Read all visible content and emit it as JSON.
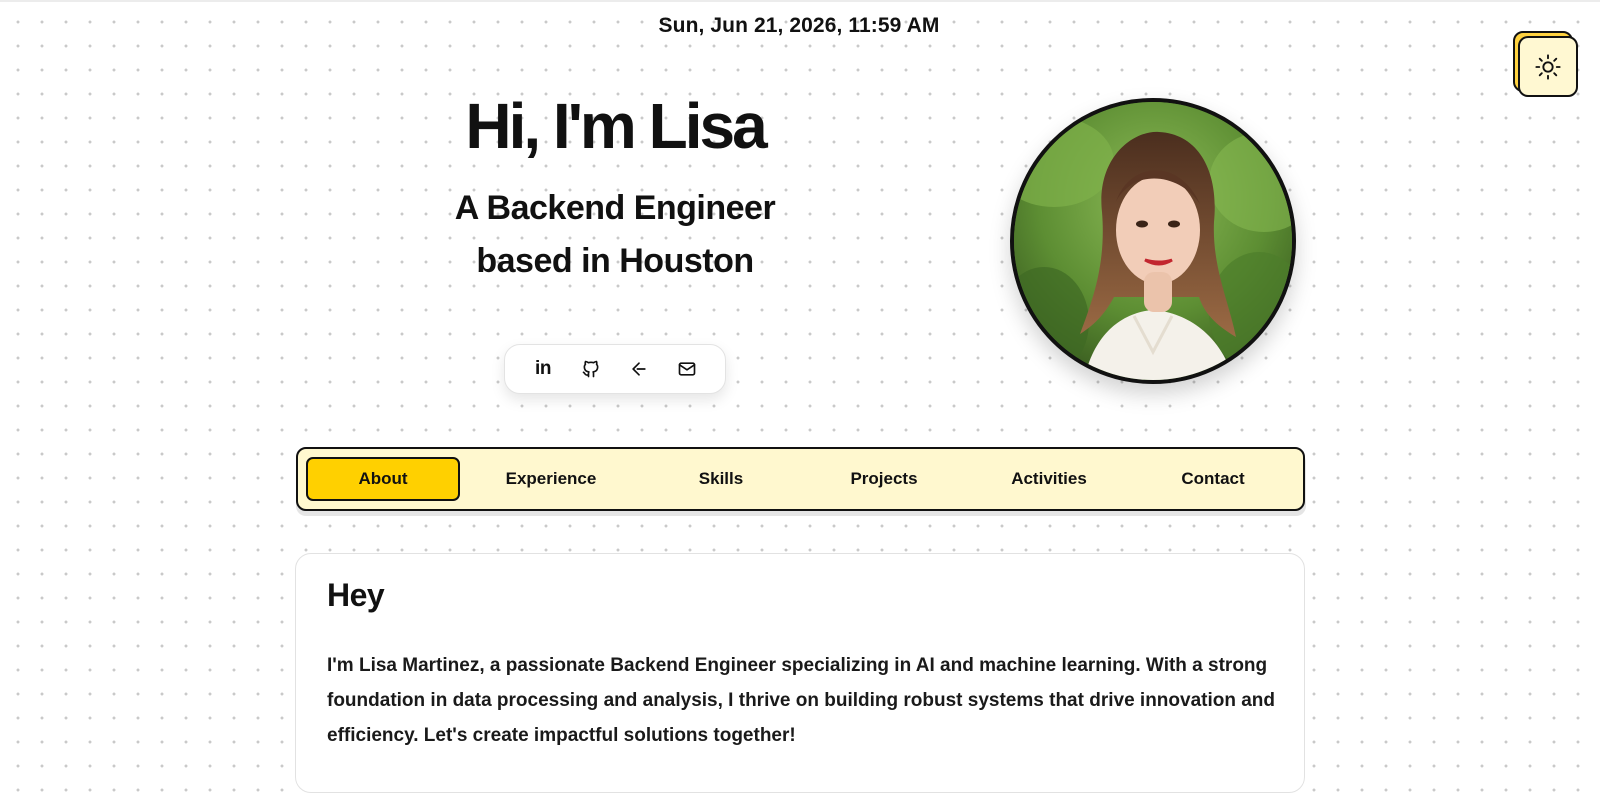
{
  "datetime": "Sun, Jun 21, 2026, 11:59 AM",
  "theme_toggle": {
    "icon": "sun-icon"
  },
  "hero": {
    "title": "Hi, I'm Lisa",
    "subtitle_line1": "A Backend Engineer",
    "subtitle_line2": "based in Houston"
  },
  "social_links": [
    {
      "name": "linkedin-icon",
      "label": "in"
    },
    {
      "name": "github-icon"
    },
    {
      "name": "code-icon"
    },
    {
      "name": "mail-icon"
    }
  ],
  "nav": {
    "active": "About",
    "tabs": [
      "About",
      "Experience",
      "Skills",
      "Projects",
      "Activities",
      "Contact"
    ]
  },
  "about": {
    "heading": "Hey",
    "body": "I'm Lisa Martinez, a passionate Backend Engineer specializing in AI and machine learning. With a strong foundation in data processing and analysis, I thrive on building robust systems that drive innovation and efficiency. Let's create impactful solutions together!"
  },
  "colors": {
    "accent": "#ffd000",
    "nav_background": "#fff8cf",
    "text": "#111111",
    "border": "#111111"
  }
}
